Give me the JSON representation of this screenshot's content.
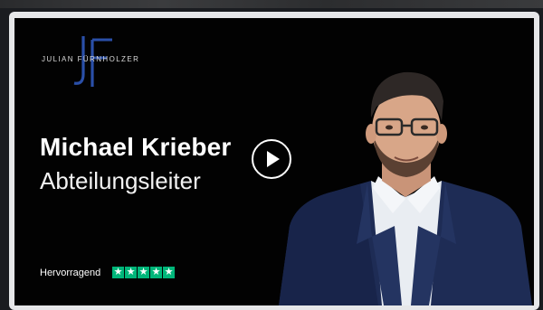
{
  "brand": {
    "logo_monogram": "JF",
    "logo_text": "JULIAN FÜRNHOLZER"
  },
  "video": {
    "name": "Michael Krieber",
    "role": "Abteilungsleiter",
    "play_icon": "play-icon"
  },
  "rating": {
    "label": "Hervorragend",
    "stars": 5,
    "star_color": "#00b67a",
    "star_glyph": "★"
  },
  "colors": {
    "logo_blue": "#2a4fa8",
    "background": "#020202"
  }
}
